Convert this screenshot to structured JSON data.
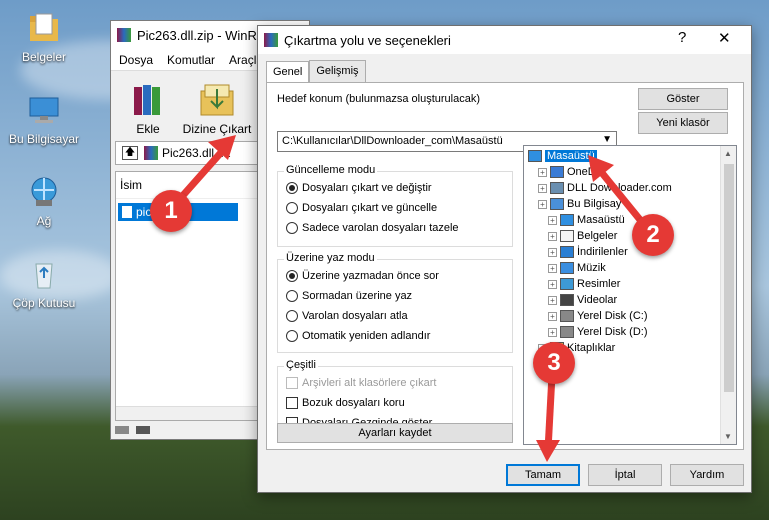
{
  "desktop": {
    "icons": [
      {
        "label": "Belgeler"
      },
      {
        "label": "Bu Bilgisayar"
      },
      {
        "label": "Ağ"
      },
      {
        "label": "Çöp Kutusu"
      }
    ]
  },
  "winrar": {
    "title": "Pic263.dll.zip - WinR",
    "menu": [
      "Dosya",
      "Komutlar",
      "Araçla"
    ],
    "toolbar": {
      "add_label": "Ekle",
      "extract_label": "Dizine Çıkart"
    },
    "path": "Pic263.dll.za",
    "column_header": "İsim",
    "file_name": "pic263.dll"
  },
  "dialog": {
    "title": "Çıkartma yolu ve seçenekleri",
    "help_symbol": "?",
    "close_symbol": "✕",
    "tabs": [
      "Genel",
      "Gelişmiş"
    ],
    "destination_label": "Hedef konum (bulunmazsa oluşturulacak)",
    "destination_value": "C:\\Kullanıcılar\\DllDownloader_com\\Masaüstü",
    "show_button": "Göster",
    "new_folder_button": "Yeni klasör",
    "update_mode": {
      "title": "Güncelleme modu",
      "options": [
        "Dosyaları çıkart ve değiştir",
        "Dosyaları çıkart ve güncelle",
        "Sadece varolan dosyaları tazele"
      ],
      "selected": 0
    },
    "overwrite_mode": {
      "title": "Üzerine yaz modu",
      "options": [
        "Üzerine yazmadan önce sor",
        "Sormadan üzerine yaz",
        "Varolan dosyaları atla",
        "Otomatik yeniden adlandır"
      ],
      "selected": 0
    },
    "misc": {
      "title": "Çeşitli",
      "options": [
        "Arşivleri alt klasörlere çıkart",
        "Bozuk dosyaları koru",
        "Dosyaları Gezginde göster"
      ],
      "disabled": [
        true,
        false,
        false
      ],
      "checked": [
        false,
        false,
        false
      ]
    },
    "save_settings_button": "Ayarları kaydet",
    "tree": [
      {
        "label": "Masaüstü",
        "level": 0,
        "selected": true,
        "icon": "desktop-icon"
      },
      {
        "label": "OneD",
        "level": 1,
        "icon": "cloud-icon"
      },
      {
        "label": "DLL Downloader.com",
        "level": 1,
        "icon": "user-icon"
      },
      {
        "label": "Bu Bilgisay",
        "level": 1,
        "icon": "computer-icon"
      },
      {
        "label": "Masaüstü",
        "level": 2,
        "icon": "desktop-icon"
      },
      {
        "label": "Belgeler",
        "level": 2,
        "icon": "document-icon"
      },
      {
        "label": "İndirilenler",
        "level": 2,
        "icon": "download-icon"
      },
      {
        "label": "Müzik",
        "level": 2,
        "icon": "music-icon"
      },
      {
        "label": "Resimler",
        "level": 2,
        "icon": "picture-icon"
      },
      {
        "label": "Videolar",
        "level": 2,
        "icon": "video-icon"
      },
      {
        "label": "Yerel Disk (C:)",
        "level": 2,
        "icon": "disk-icon"
      },
      {
        "label": "Yerel Disk (D:)",
        "level": 2,
        "icon": "disk-icon"
      },
      {
        "label": "Kitaplıklar",
        "level": 1,
        "icon": "library-icon"
      },
      {
        "label": "ğ",
        "level": 1,
        "icon": "network-icon"
      }
    ],
    "ok_button": "Tamam",
    "cancel_button": "İptal",
    "help_button": "Yardım"
  },
  "markers": [
    "1",
    "2",
    "3"
  ],
  "colors": {
    "accent": "#0078d7",
    "marker": "#e53935"
  }
}
